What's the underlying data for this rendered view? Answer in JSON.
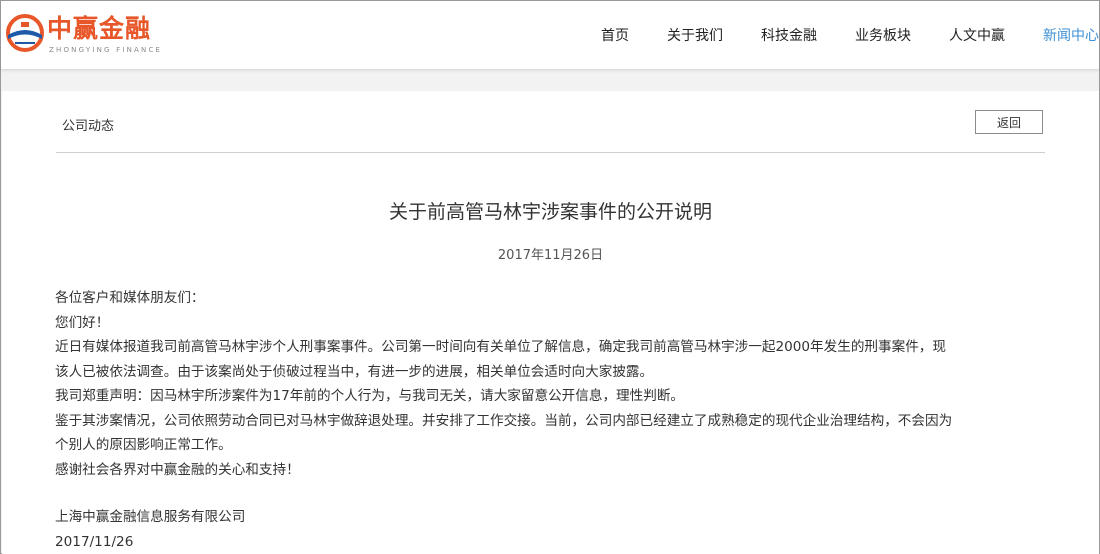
{
  "header": {
    "logo_cn": "中赢金融",
    "logo_en": "ZHONGYING FINANCE",
    "nav": [
      {
        "label": "首页"
      },
      {
        "label": "关于我们"
      },
      {
        "label": "科技金融"
      },
      {
        "label": "业务板块"
      },
      {
        "label": "人文中赢"
      },
      {
        "label": "新闻中心"
      }
    ],
    "active_nav": "新闻中心"
  },
  "content": {
    "breadcrumb": "公司动态",
    "back_label": "返回",
    "title": "关于前高管马林宇涉案事件的公开说明",
    "date": "2017年11月26日",
    "lines": [
      "各位客户和媒体朋友们：",
      "您们好！",
      "近日有媒体报道我司前高管马林宇涉个人刑事案事件。公司第一时间向有关单位了解信息，确定我司前高管马林宇涉一起2000年发生的刑事案件，现",
      "该人已被依法调查。由于该案尚处于侦破过程当中，有进一步的进展，相关单位会适时向大家披露。",
      "我司郑重声明：因马林宇所涉案件为17年前的个人行为，与我司无关，请大家留意公开信息，理性判断。",
      "鉴于其涉案情况，公司依照劳动合同已对马林宇做辞退处理。并安排了工作交接。当前，公司内部已经建立了成熟稳定的现代企业治理结构，不会因为",
      "个别人的原因影响正常工作。",
      "感谢社会各界对中赢金融的关心和支持！"
    ],
    "signature_company": "上海中赢金融信息服务有限公司",
    "signature_date": "2017/11/26"
  },
  "colors": {
    "brand_orange": "#e8572a",
    "brand_blue": "#1e5aa8",
    "nav_active": "#3e8fd6",
    "page_bg": "#f2f2f2"
  }
}
